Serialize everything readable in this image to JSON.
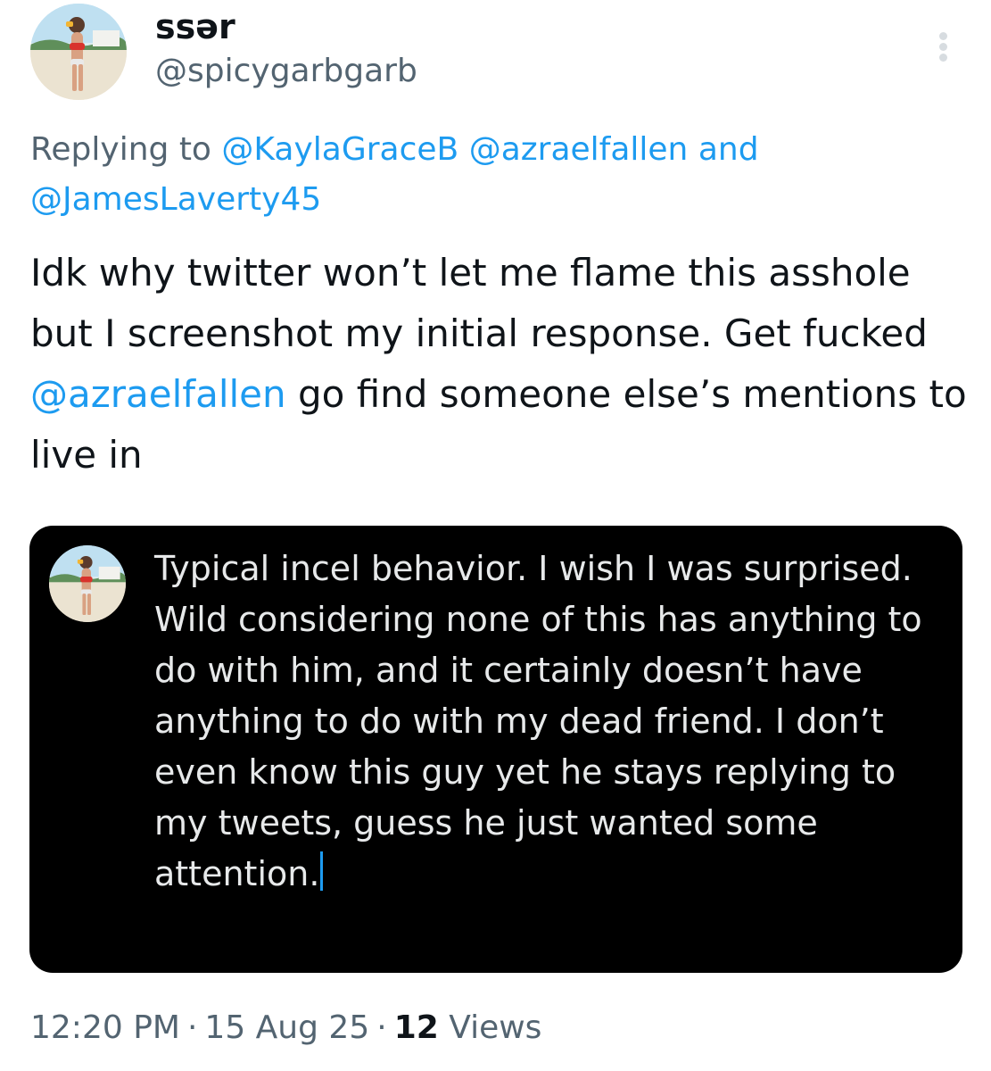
{
  "author": {
    "display_name": "ssər",
    "handle": "@spicygarbgarb",
    "avatar_icon": "profile-photo-avatar"
  },
  "more_icon": "more-vertical-icon",
  "reply_context": {
    "prefix": "Replying to",
    "mentions": [
      "@KaylaGraceB",
      "@azraelfallen",
      "@JamesLaverty45"
    ],
    "conjunction": "and"
  },
  "body": {
    "text_before": "Idk why twitter won’t let me flame this asshole but I screenshot my initial response. Get fucked",
    "mention": "@azraelfallen",
    "text_after": "go find someone else’s mentions to live in"
  },
  "embedded_screenshot": {
    "text": "Typical incel behavior. I wish I was surprised. Wild considering none of this has anything to do with him, and it certainly doesn’t have anything to do with my dead friend. I don’t even know this guy yet he stays replying to my tweets, guess he just wanted some attention."
  },
  "meta": {
    "time": "12:20 PM",
    "date": "15 Aug 25",
    "views_count": "12",
    "views_label": "Views",
    "separator": "·"
  },
  "colors": {
    "link": "#1d9bf0",
    "secondary_text": "#536471",
    "primary_text": "#0f1419",
    "media_background": "#000000",
    "media_text": "#e7e9ea"
  }
}
